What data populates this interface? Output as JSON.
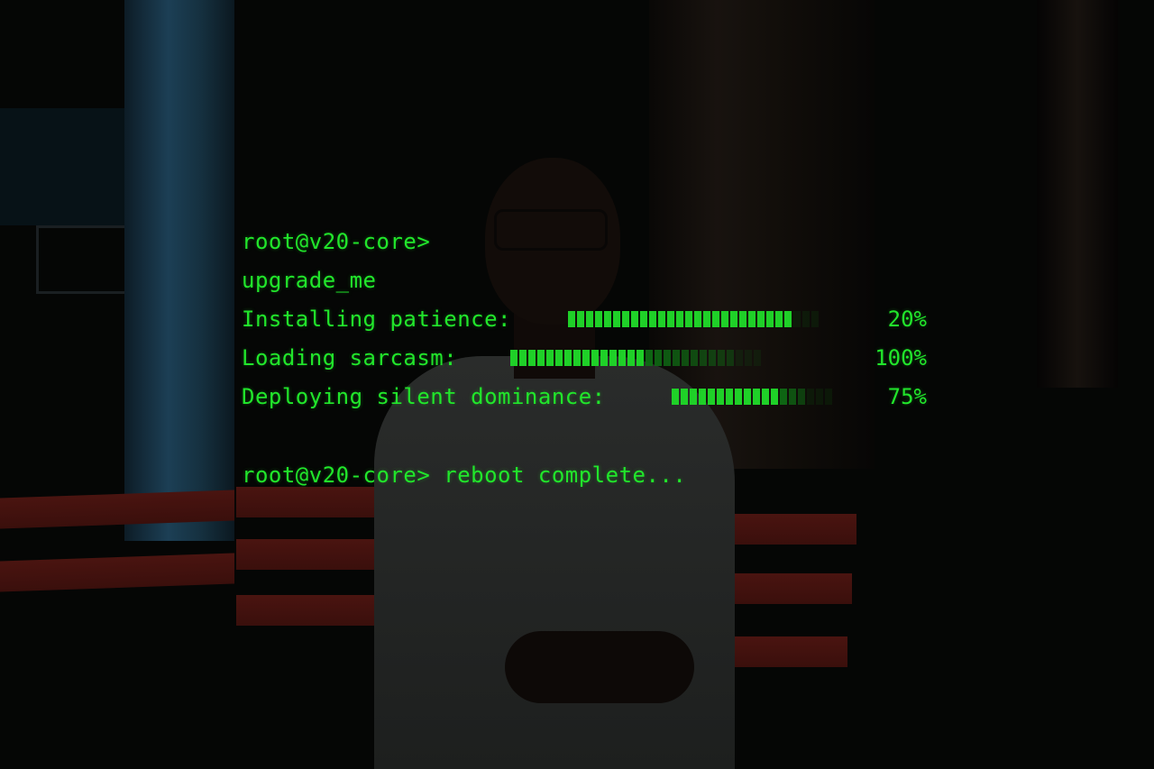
{
  "terminal": {
    "prompt": "root@v20-core>",
    "command": "upgrade_me",
    "tasks": [
      {
        "label": "Installing patience:",
        "percent_text": "20%",
        "filled_segments": 25,
        "bright_segments": 25
      },
      {
        "label": "Loading sarcasm:",
        "percent_text": "100%",
        "filled_segments": 25,
        "bright_segments": 15
      },
      {
        "label": "Deploying silent dominance:",
        "percent_text": "75%",
        "filled_segments": 15,
        "bright_segments": 12
      }
    ],
    "final_line": "root@v20-core> reboot complete..."
  },
  "colors": {
    "terminal_green": "#21e62b",
    "segment_bright": "#1fd028",
    "segment_dim": "#0f6a14"
  }
}
